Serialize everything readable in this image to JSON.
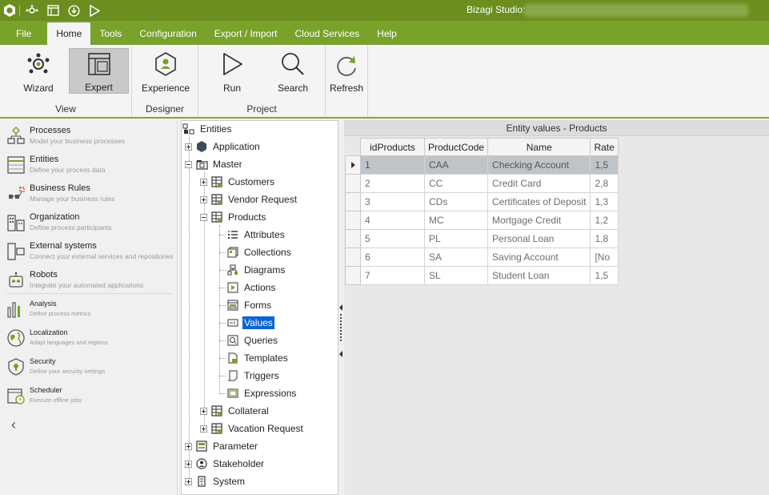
{
  "titlebar": {
    "title": "Bizagi Studio:"
  },
  "menu": [
    "File",
    "Home",
    "Tools",
    "Configuration",
    "Export / Import",
    "Cloud Services",
    "Help"
  ],
  "ribbon": {
    "view": {
      "label": "View",
      "wizard": "Wizard",
      "expert": "Expert"
    },
    "designer": {
      "label": "Designer",
      "experience": "Experience"
    },
    "project": {
      "label": "Project",
      "run": "Run",
      "search": "Search"
    },
    "refresh": "Refresh"
  },
  "nav": {
    "processes": {
      "title": "Processes",
      "sub": "Model your business processes"
    },
    "entities": {
      "title": "Entities",
      "sub": "Define your process data"
    },
    "rules": {
      "title": "Business Rules",
      "sub": "Manage your business rules"
    },
    "organization": {
      "title": "Organization",
      "sub": "Define process participants"
    },
    "external": {
      "title": "External systems",
      "sub": "Connect your external services and repositories"
    },
    "robots": {
      "title": "Robots",
      "sub": "Integrate your automated applications"
    },
    "analysis": {
      "title": "Analysis",
      "sub": "Define process metrics"
    },
    "localization": {
      "title": "Localization",
      "sub": "Adapt languages and regions"
    },
    "security": {
      "title": "Security",
      "sub": "Define your security settings"
    },
    "scheduler": {
      "title": "Scheduler",
      "sub": "Execute offline jobs"
    }
  },
  "tree": {
    "root": "Entities",
    "application": "Application",
    "master": "Master",
    "customers": "Customers",
    "vendor_request": "Vendor Request",
    "products": "Products",
    "attributes": "Attributes",
    "collections": "Collections",
    "diagrams": "Diagrams",
    "actions": "Actions",
    "forms": "Forms",
    "values": "Values",
    "queries": "Queries",
    "templates": "Templates",
    "triggers": "Triggers",
    "expressions": "Expressions",
    "collateral": "Collateral",
    "vacation_request": "Vacation Request",
    "parameter": "Parameter",
    "stakeholder": "Stakeholder",
    "system": "System"
  },
  "grid": {
    "title": "Entity values - Products",
    "columns": [
      "idProducts",
      "ProductCode",
      "Name",
      "Rate"
    ],
    "rows": [
      [
        "1",
        "CAA",
        "Checking Account",
        "1,5"
      ],
      [
        "2",
        "CC",
        "Credit Card",
        "2,8"
      ],
      [
        "3",
        "CDs",
        "Certificates of Deposit",
        "1,3"
      ],
      [
        "4",
        "MC",
        "Mortgage Credit",
        "1,2"
      ],
      [
        "5",
        "PL",
        "Personal Loan",
        "1,8"
      ],
      [
        "6",
        "SA",
        "Saving Account",
        "[No"
      ],
      [
        "7",
        "SL",
        "Student Loan",
        "1,5"
      ]
    ]
  }
}
